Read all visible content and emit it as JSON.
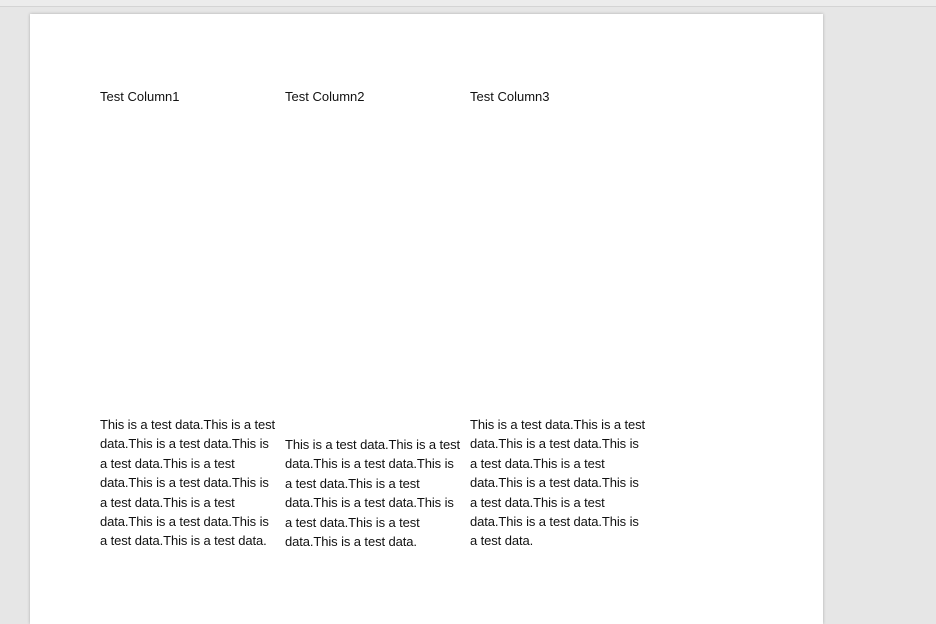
{
  "table": {
    "headers": [
      "Test Column1",
      "Test Column2",
      "Test Column3"
    ],
    "rows": [
      [
        "This is a test data.This is a test data.This is a test data.This is a test data.This is a test data.This is a test data.This is a test data.This is a test data.This is a test data.This is a test data.This is a test data.",
        "This is a test data.This is a test data.This is a test data.This is a test data.This is a test data.This is a test data.This is a test data.This is a test data.This is a test data.",
        "This is a test data.This is a test data.This is a test data.This is a test data.This is a test data.This is a test data.This is a test data.This is a test data.This is a test data.This is a test data."
      ]
    ]
  }
}
